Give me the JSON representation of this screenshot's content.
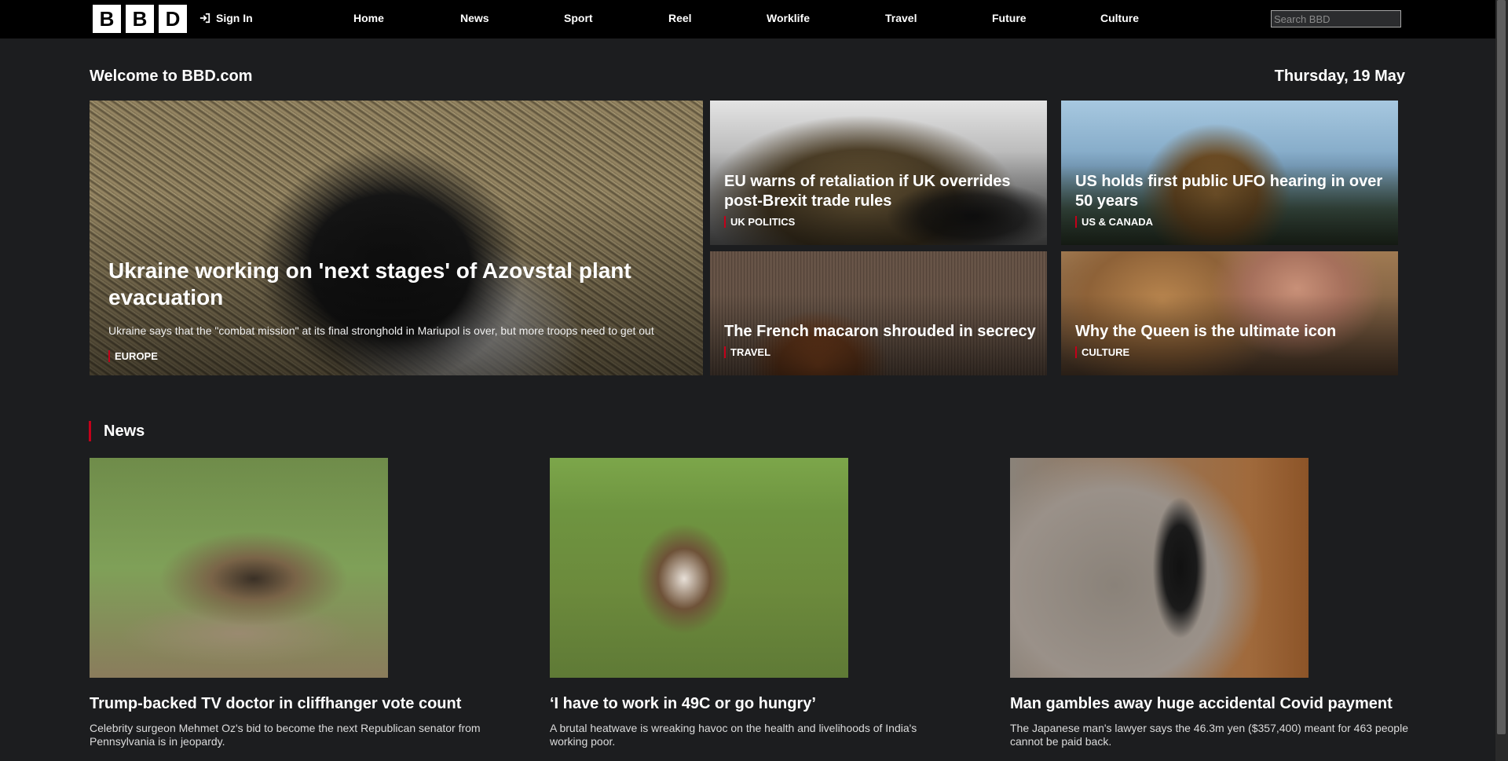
{
  "nav": {
    "logo_letters": [
      "B",
      "B",
      "D"
    ],
    "sign_in": "Sign In",
    "items": [
      "Home",
      "News",
      "Sport",
      "Reel",
      "Worklife",
      "Travel",
      "Future",
      "Culture"
    ],
    "search_placeholder": "Search BBD"
  },
  "header": {
    "welcome": "Welcome to BBD.com",
    "date": "Thursday, 19 May"
  },
  "hero": {
    "main": {
      "title": "Ukraine working on 'next stages' of Azovstal plant evacuation",
      "summary": "Ukraine says that the \"combat mission\" at its final stronghold in Mariupol is over, but more troops need to get out",
      "tag": "EUROPE"
    },
    "tiles": [
      {
        "title": "EU warns of retaliation if UK overrides post-Brexit trade rules",
        "tag": "UK POLITICS"
      },
      {
        "title": "US holds first public UFO hearing in over 50 years",
        "tag": "US & CANADA"
      },
      {
        "title": "The French macaron shrouded in secrecy",
        "tag": "TRAVEL"
      },
      {
        "title": "Why the Queen is the ultimate icon",
        "tag": "CULTURE"
      }
    ]
  },
  "news": {
    "heading": "News",
    "cards": [
      {
        "title": "Trump-backed TV doctor in cliffhanger vote count",
        "summary": "Celebrity surgeon Mehmet Oz's bid to become the next Republican senator from Pennsylvania is in jeopardy."
      },
      {
        "title": "‘I have to work in 49C or go hungry’",
        "summary": "A brutal heatwave is wreaking havoc on the health and livelihoods of India's working poor."
      },
      {
        "title": "Man gambles away huge accidental Covid payment",
        "summary": "The Japanese man's lawyer says the 46.3m yen ($357,400) meant for 463 people cannot be paid back."
      }
    ]
  },
  "colors": {
    "background": "#1c1d1f",
    "topbar": "#000000",
    "accent": "#c4001a"
  }
}
